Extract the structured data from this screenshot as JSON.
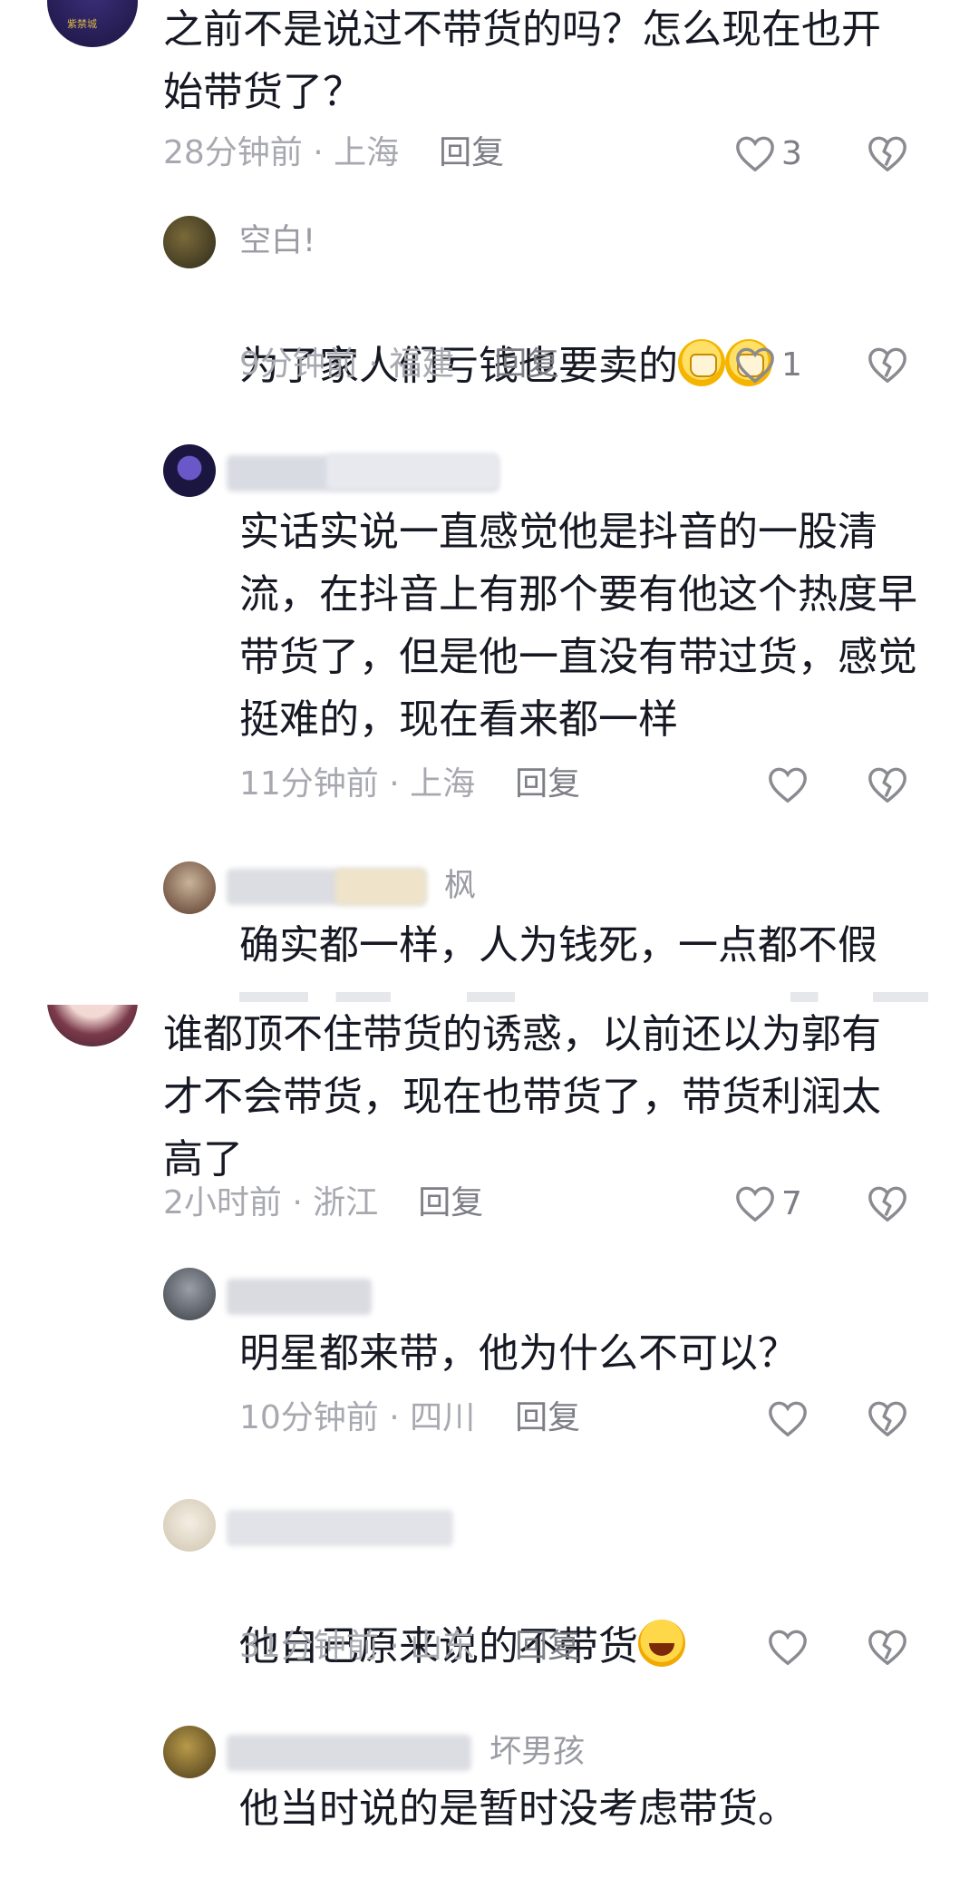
{
  "comments_top": [
    {
      "text": "之前不是说过不带货的吗？怎么现在也开\n始带货了？",
      "time": "28分钟前",
      "location": "上海",
      "reply_label": "回复",
      "likes": "3",
      "avatar_badge": "紫禁城",
      "replies": [
        {
          "username": "空白!",
          "text": "为了家人们亏钱也要卖的",
          "time": "9分钟前",
          "location": "福建",
          "reply_label": "回复",
          "likes": "1"
        },
        {
          "username": "",
          "text": "实话实说一直感觉他是抖音的一股清\n流，在抖音上有那个要有他这个热度早\n带货了，但是他一直没有带过货，感觉\n挺难的，现在看来都一样",
          "time": "11分钟前",
          "location": "上海",
          "reply_label": "回复",
          "likes": ""
        },
        {
          "username": "枫",
          "text": "确实都一样，人为钱死，一点都不假"
        }
      ]
    }
  ],
  "comments_bottom": [
    {
      "text": "谁都顶不住带货的诱惑，以前还以为郭有\n才不会带货，现在也带货了，带货利润太\n高了",
      "time": "2小时前",
      "location": "浙江",
      "reply_label": "回复",
      "likes": "7",
      "replies": [
        {
          "username": "",
          "text": "明星都来带，他为什么不可以？",
          "time": "10分钟前",
          "location": "四川",
          "reply_label": "回复",
          "likes": ""
        },
        {
          "username": "",
          "text": "他自己原来说的不带货",
          "time": "31分钟前",
          "location": "山东",
          "reply_label": "回复",
          "likes": ""
        },
        {
          "username": "坏男孩",
          "text": "他当时说的是暂时没考虑带货。"
        }
      ]
    }
  ],
  "separator": " · ",
  "icons": {
    "like": "heart-outline-icon",
    "dislike": "broken-heart-icon"
  },
  "colors": {
    "text": "#161823",
    "meta": "#a8a9b0",
    "icon": "#8a8b91",
    "divider": "#e8e8e8"
  }
}
